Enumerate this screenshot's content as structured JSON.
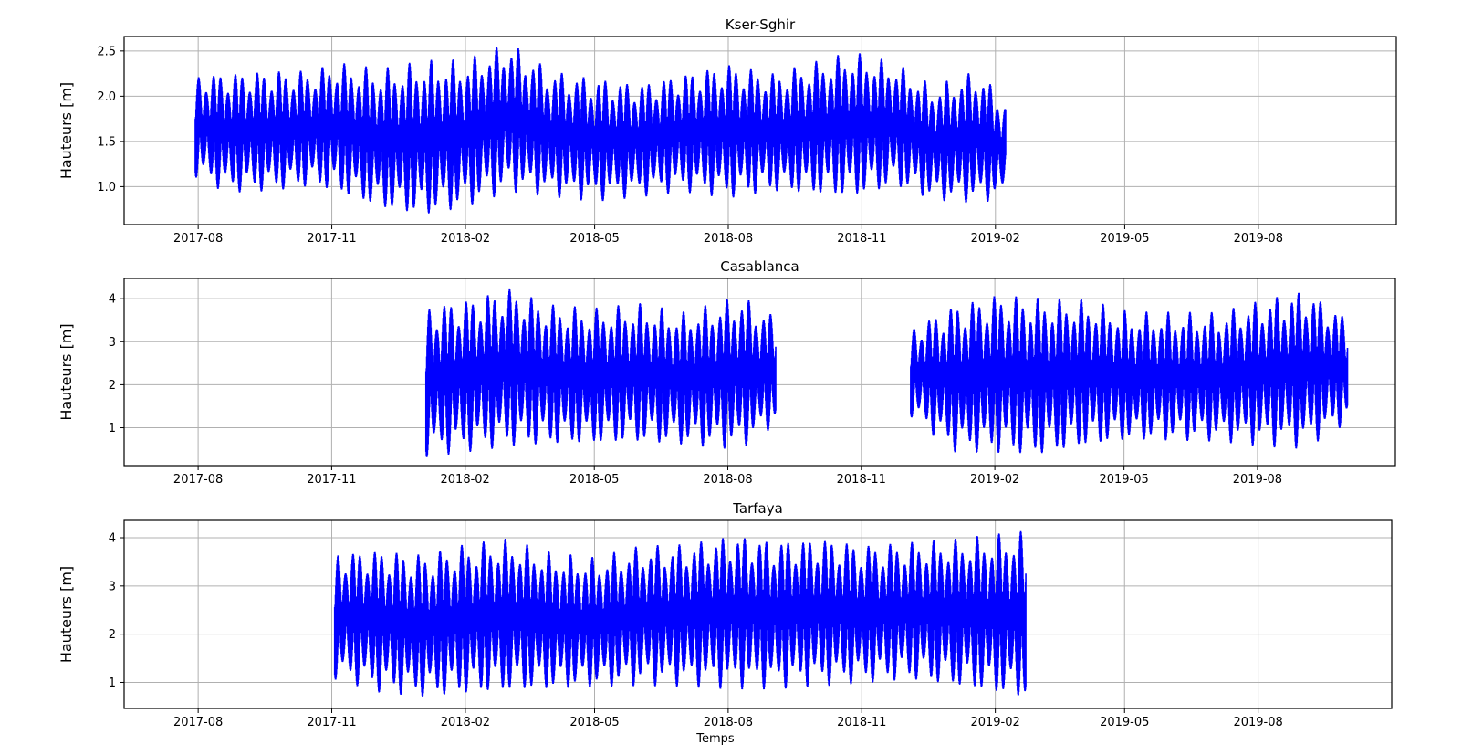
{
  "figure": {
    "xlabel": "Temps"
  },
  "chart_data": [
    {
      "type": "area",
      "title": "Kser-Sghir",
      "ylabel": "Hauteurs [m]",
      "xlim": [
        "2017-06-11",
        "2019-11-04"
      ],
      "ylim": [
        0.58,
        2.66
      ],
      "yticks": [
        1.0,
        1.5,
        2.0,
        2.5
      ],
      "ytick_labels": [
        "1.0",
        "1.5",
        "2.0",
        "2.5"
      ],
      "xticks": [
        "2017-08-01",
        "2017-11-01",
        "2018-02-01",
        "2018-05-01",
        "2018-08-01",
        "2018-11-01",
        "2019-02-01",
        "2019-05-01",
        "2019-08-01"
      ],
      "xtick_labels": [
        "2017-08",
        "2017-11",
        "2018-02",
        "2018-05",
        "2018-08",
        "2018-11",
        "2019-02",
        "2019-05",
        "2019-08"
      ],
      "grid": true,
      "color": "#0000ff",
      "segments": [
        {
          "start": "2017-07-30",
          "end": "2019-02-08",
          "envelope": [
            {
              "date": "2017-07-30",
              "high": 2.26,
              "low": 1.1
            },
            {
              "date": "2017-08-20",
              "high": 2.28,
              "low": 0.92
            },
            {
              "date": "2017-09-20",
              "high": 2.3,
              "low": 0.93
            },
            {
              "date": "2017-10-20",
              "high": 2.3,
              "low": 0.98
            },
            {
              "date": "2017-11-03",
              "high": 2.39,
              "low": 0.92
            },
            {
              "date": "2017-12-05",
              "high": 2.31,
              "low": 0.72
            },
            {
              "date": "2018-01-03",
              "high": 2.4,
              "low": 0.65
            },
            {
              "date": "2018-02-01",
              "high": 2.41,
              "low": 0.74
            },
            {
              "date": "2018-03-03",
              "high": 2.61,
              "low": 0.93
            },
            {
              "date": "2018-04-01",
              "high": 2.3,
              "low": 0.88
            },
            {
              "date": "2018-05-01",
              "high": 2.22,
              "low": 0.83
            },
            {
              "date": "2018-06-01",
              "high": 2.16,
              "low": 0.88
            },
            {
              "date": "2018-07-01",
              "high": 2.27,
              "low": 0.93
            },
            {
              "date": "2018-08-01",
              "high": 2.38,
              "low": 0.85
            },
            {
              "date": "2018-09-01",
              "high": 2.27,
              "low": 0.92
            },
            {
              "date": "2018-10-01",
              "high": 2.4,
              "low": 0.88
            },
            {
              "date": "2018-10-25",
              "high": 2.5,
              "low": 0.85
            },
            {
              "date": "2018-11-25",
              "high": 2.37,
              "low": 0.98
            },
            {
              "date": "2018-12-20",
              "high": 2.12,
              "low": 0.83
            },
            {
              "date": "2019-01-20",
              "high": 2.3,
              "low": 0.8
            },
            {
              "date": "2019-02-08",
              "high": 1.95,
              "low": 0.87
            }
          ]
        }
      ]
    },
    {
      "type": "area",
      "title": "Casablanca",
      "ylabel": "Hauteurs [m]",
      "xlim": [
        "2017-06-11",
        "2019-11-04"
      ],
      "ylim": [
        0.12,
        4.47
      ],
      "yticks": [
        1,
        2,
        3,
        4
      ],
      "ytick_labels": [
        "1",
        "2",
        "3",
        "4"
      ],
      "xticks": [
        "2017-08-01",
        "2017-11-01",
        "2018-02-01",
        "2018-05-01",
        "2018-08-01",
        "2018-11-01",
        "2019-02-01",
        "2019-05-01",
        "2019-08-01"
      ],
      "xtick_labels": [
        "2017-08",
        "2017-11",
        "2018-02",
        "2018-05",
        "2018-08",
        "2018-11",
        "2019-02",
        "2019-05",
        "2019-08"
      ],
      "grid": true,
      "color": "#0000ff",
      "segments": [
        {
          "start": "2018-01-05",
          "end": "2018-09-03",
          "envelope": [
            {
              "date": "2018-01-05",
              "high": 3.9,
              "low": 0.3
            },
            {
              "date": "2018-02-03",
              "high": 4.05,
              "low": 0.4
            },
            {
              "date": "2018-03-03",
              "high": 4.3,
              "low": 0.5
            },
            {
              "date": "2018-04-01",
              "high": 3.9,
              "low": 0.55
            },
            {
              "date": "2018-05-01",
              "high": 3.8,
              "low": 0.55
            },
            {
              "date": "2018-06-01",
              "high": 3.9,
              "low": 0.6
            },
            {
              "date": "2018-07-01",
              "high": 3.7,
              "low": 0.55
            },
            {
              "date": "2018-08-10",
              "high": 4.1,
              "low": 0.45
            },
            {
              "date": "2018-09-03",
              "high": 3.6,
              "low": 1.05
            }
          ]
        },
        {
          "start": "2018-12-05",
          "end": "2019-10-02",
          "envelope": [
            {
              "date": "2018-12-05",
              "high": 3.35,
              "low": 1.25
            },
            {
              "date": "2019-01-03",
              "high": 3.9,
              "low": 0.4
            },
            {
              "date": "2019-02-03",
              "high": 4.15,
              "low": 0.35
            },
            {
              "date": "2019-03-05",
              "high": 4.05,
              "low": 0.3
            },
            {
              "date": "2019-04-05",
              "high": 4.0,
              "low": 0.5
            },
            {
              "date": "2019-05-05",
              "high": 3.7,
              "low": 0.65
            },
            {
              "date": "2019-06-05",
              "high": 3.7,
              "low": 0.65
            },
            {
              "date": "2019-07-05",
              "high": 3.7,
              "low": 0.65
            },
            {
              "date": "2019-08-03",
              "high": 4.0,
              "low": 0.55
            },
            {
              "date": "2019-09-03",
              "high": 4.25,
              "low": 0.5
            },
            {
              "date": "2019-10-02",
              "high": 3.6,
              "low": 1.1
            }
          ]
        }
      ]
    },
    {
      "type": "area",
      "title": "Tarfaya",
      "ylabel": "Hauteurs [m]",
      "xlim": [
        "2017-06-11",
        "2019-11-01"
      ],
      "ylim": [
        0.46,
        4.36
      ],
      "yticks": [
        1,
        2,
        3,
        4
      ],
      "ytick_labels": [
        "1",
        "2",
        "3",
        "4"
      ],
      "xticks": [
        "2017-08-01",
        "2017-11-01",
        "2018-02-01",
        "2018-05-01",
        "2018-08-01",
        "2018-11-01",
        "2019-02-01",
        "2019-05-01",
        "2019-08-01"
      ],
      "xtick_labels": [
        "2017-08",
        "2017-11",
        "2018-02",
        "2018-05",
        "2018-08",
        "2018-11",
        "2019-02",
        "2019-05",
        "2019-08"
      ],
      "grid": true,
      "color": "#0000ff",
      "segments": [
        {
          "start": "2017-11-03",
          "end": "2019-02-22",
          "envelope": [
            {
              "date": "2017-11-03",
              "high": 3.75,
              "low": 1.05
            },
            {
              "date": "2017-12-05",
              "high": 3.8,
              "low": 0.75
            },
            {
              "date": "2018-01-03",
              "high": 3.7,
              "low": 0.65
            },
            {
              "date": "2018-02-01",
              "high": 3.9,
              "low": 0.7
            },
            {
              "date": "2018-03-03",
              "high": 4.0,
              "low": 0.75
            },
            {
              "date": "2018-04-01",
              "high": 3.7,
              "low": 0.8
            },
            {
              "date": "2018-05-01",
              "high": 3.6,
              "low": 0.85
            },
            {
              "date": "2018-06-01",
              "high": 3.85,
              "low": 0.9
            },
            {
              "date": "2018-07-01",
              "high": 3.9,
              "low": 0.9
            },
            {
              "date": "2018-08-05",
              "high": 4.1,
              "low": 0.85
            },
            {
              "date": "2018-09-01",
              "high": 4.0,
              "low": 0.85
            },
            {
              "date": "2018-10-05",
              "high": 4.05,
              "low": 0.9
            },
            {
              "date": "2018-11-05",
              "high": 3.9,
              "low": 0.95
            },
            {
              "date": "2018-12-05",
              "high": 3.95,
              "low": 1.0
            },
            {
              "date": "2019-01-05",
              "high": 4.0,
              "low": 0.85
            },
            {
              "date": "2019-02-22",
              "high": 4.15,
              "low": 0.6
            }
          ]
        }
      ]
    }
  ]
}
